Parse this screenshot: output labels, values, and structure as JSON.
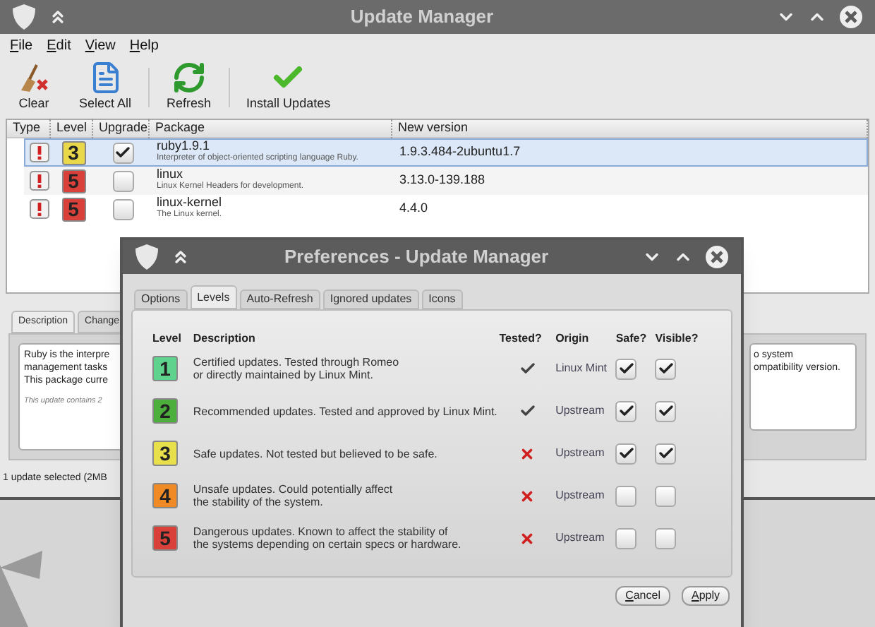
{
  "window": {
    "title": "Update Manager"
  },
  "menu": [
    {
      "label": "File"
    },
    {
      "label": "Edit"
    },
    {
      "label": "View"
    },
    {
      "label": "Help"
    }
  ],
  "toolbar": [
    {
      "label": "Clear",
      "kind": "clear"
    },
    {
      "label": "Select All",
      "kind": "select"
    },
    {
      "label": "Refresh",
      "kind": "refresh"
    },
    {
      "label": "Install Updates",
      "kind": "install"
    }
  ],
  "packages": {
    "columns": [
      "Type",
      "Level",
      "Upgrade",
      "Package",
      "New version"
    ],
    "rows": [
      {
        "level": "3",
        "color": "#e8d84a",
        "upgrade": true,
        "selected": true,
        "name": "ruby1.9.1",
        "description": "Interpreter of object-oriented scripting language Ruby.",
        "version": "1.9.3.484-2ubuntu1.7"
      },
      {
        "level": "5",
        "color": "#d9403a",
        "upgrade": false,
        "selected": false,
        "name": "linux",
        "description": "Linux Kernel Headers for development.",
        "version": "3.13.0-139.188"
      },
      {
        "level": "5",
        "color": "#d9403a",
        "upgrade": false,
        "selected": false,
        "name": "linux-kernel",
        "description": "The Linux kernel.",
        "version": "4.4.0"
      }
    ]
  },
  "details": {
    "tabs": [
      {
        "label": "Description",
        "selected": true
      },
      {
        "label": "Change",
        "selected": false
      }
    ],
    "lines": [
      "Ruby is the interpre",
      "management tasks",
      "This package curre"
    ],
    "note": "This update contains 2",
    "right_lines": [
      "o system",
      "ompatibility version."
    ]
  },
  "status_bar": "1 update selected (2MB",
  "dialog": {
    "title": "Preferences - Update Manager",
    "tabs": [
      {
        "label": "Options",
        "selected": false
      },
      {
        "label": "Levels",
        "selected": true
      },
      {
        "label": "Auto-Refresh",
        "selected": false
      },
      {
        "label": "Ignored updates",
        "selected": false
      },
      {
        "label": "Icons",
        "selected": false
      }
    ],
    "columns": [
      "Level",
      "Description",
      "Tested?",
      "Origin",
      "Safe?",
      "Visible?"
    ],
    "levels": [
      {
        "level": "1",
        "color": "#5fd38d",
        "description": "Certified updates. Tested through Romeo\nor directly maintained by Linux Mint.",
        "tested": true,
        "origin": "Linux Mint",
        "safe": true,
        "visible": true
      },
      {
        "level": "2",
        "color": "#4caf3c",
        "description": "Recommended updates. Tested and approved by Linux Mint.",
        "tested": true,
        "origin": "Upstream",
        "safe": true,
        "visible": true
      },
      {
        "level": "3",
        "color": "#e8e04a",
        "description": "Safe updates. Not tested but believed to be safe.",
        "tested": false,
        "origin": "Upstream",
        "safe": true,
        "visible": true
      },
      {
        "level": "4",
        "color": "#f08a24",
        "description": "Unsafe updates. Could potentially affect\nthe stability of the system.",
        "tested": false,
        "origin": "Upstream",
        "safe": false,
        "visible": false
      },
      {
        "level": "5",
        "color": "#d9403a",
        "description": "Dangerous updates. Known to affect the stability of\nthe systems depending on certain specs or hardware.",
        "tested": false,
        "origin": "Upstream",
        "safe": false,
        "visible": false
      }
    ],
    "buttons": [
      "Cancel",
      "Apply"
    ]
  }
}
